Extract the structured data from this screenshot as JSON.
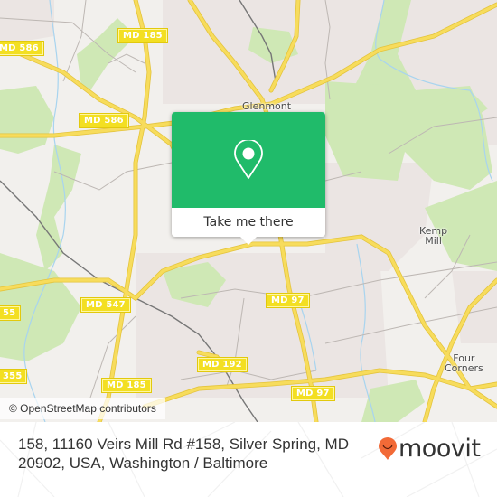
{
  "map": {
    "attribution": "© OpenStreetMap contributors",
    "places": [
      {
        "id": "glenmont",
        "label": "Glenmont"
      },
      {
        "id": "kemp-mill",
        "label": "Kemp\nMill"
      },
      {
        "id": "four-corners",
        "label": "Four\nCorners"
      }
    ],
    "road_shields": [
      {
        "id": "md586-left",
        "label": "MD 586"
      },
      {
        "id": "md185-top",
        "label": "MD 185"
      },
      {
        "id": "md586-mid",
        "label": "MD 586"
      },
      {
        "id": "md547",
        "label": "MD 547"
      },
      {
        "id": "md355-a",
        "label": "55"
      },
      {
        "id": "md355-b",
        "label": "355"
      },
      {
        "id": "md185-bottom",
        "label": "MD 185"
      },
      {
        "id": "md192",
        "label": "MD 192"
      },
      {
        "id": "md97-a",
        "label": "MD 97"
      },
      {
        "id": "md97-b",
        "label": "MD 97"
      }
    ],
    "colors": {
      "background": "#f2f0ed",
      "residential": "#ebe5e3",
      "park": "#cfe8b5",
      "major_road": "#f7dc5c",
      "water": "#a8d4ef",
      "rail": "#777777"
    }
  },
  "popup": {
    "icon": "map-pin-icon",
    "button_label": "Take me there",
    "color": "#20bb6a"
  },
  "footer": {
    "address": "158, 11160 Veirs Mill Rd #158, Silver Spring, MD 20902, USA, Washington / Baltimore",
    "logo_text": "moovit",
    "logo_icon": "moovit-pin-smile-icon",
    "logo_color": "#f26a37"
  }
}
